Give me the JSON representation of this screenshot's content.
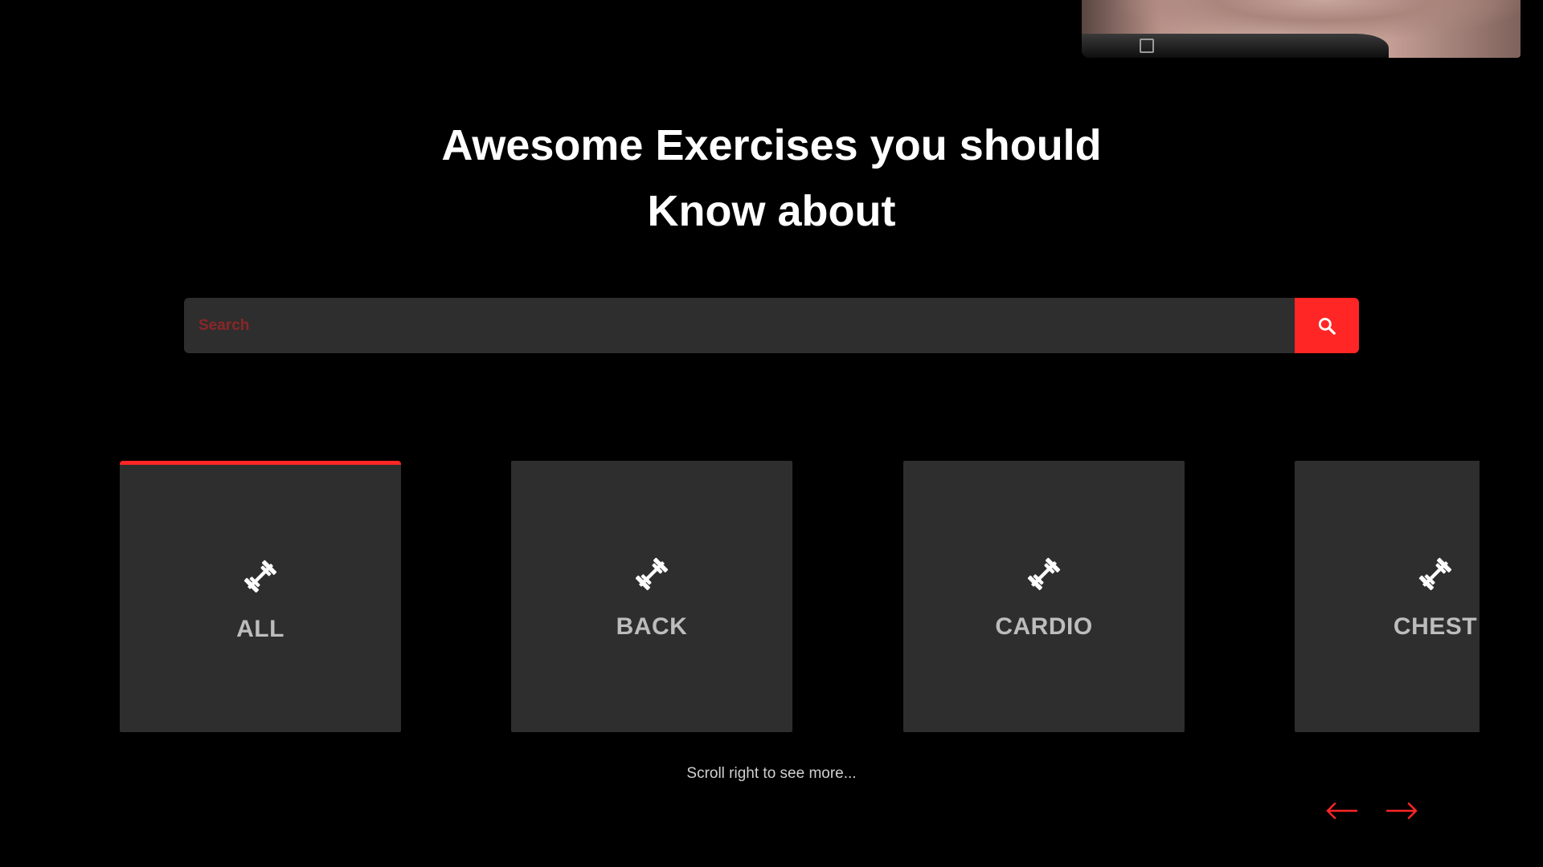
{
  "hero": {
    "image_description": "muscular torso with black waistband"
  },
  "headline": {
    "line1": "Awesome Exercises you should",
    "line2": "Know about"
  },
  "search": {
    "placeholder": "Search",
    "value": "",
    "button_icon": "search-icon"
  },
  "categories": {
    "items": [
      {
        "label": "ALL",
        "icon": "dumbbell-icon",
        "active": true
      },
      {
        "label": "BACK",
        "icon": "dumbbell-icon",
        "active": false
      },
      {
        "label": "CARDIO",
        "icon": "dumbbell-icon",
        "active": false
      },
      {
        "label": "CHEST",
        "icon": "dumbbell-icon",
        "active": false
      }
    ]
  },
  "scroll_hint": "Scroll right to see more...",
  "navigation": {
    "prev_icon": "arrow-left-icon",
    "next_icon": "arrow-right-icon"
  },
  "colors": {
    "accent": "#ff2625",
    "background": "#000000",
    "card": "#2e2e2e",
    "card_label": "#bdbdbd"
  }
}
